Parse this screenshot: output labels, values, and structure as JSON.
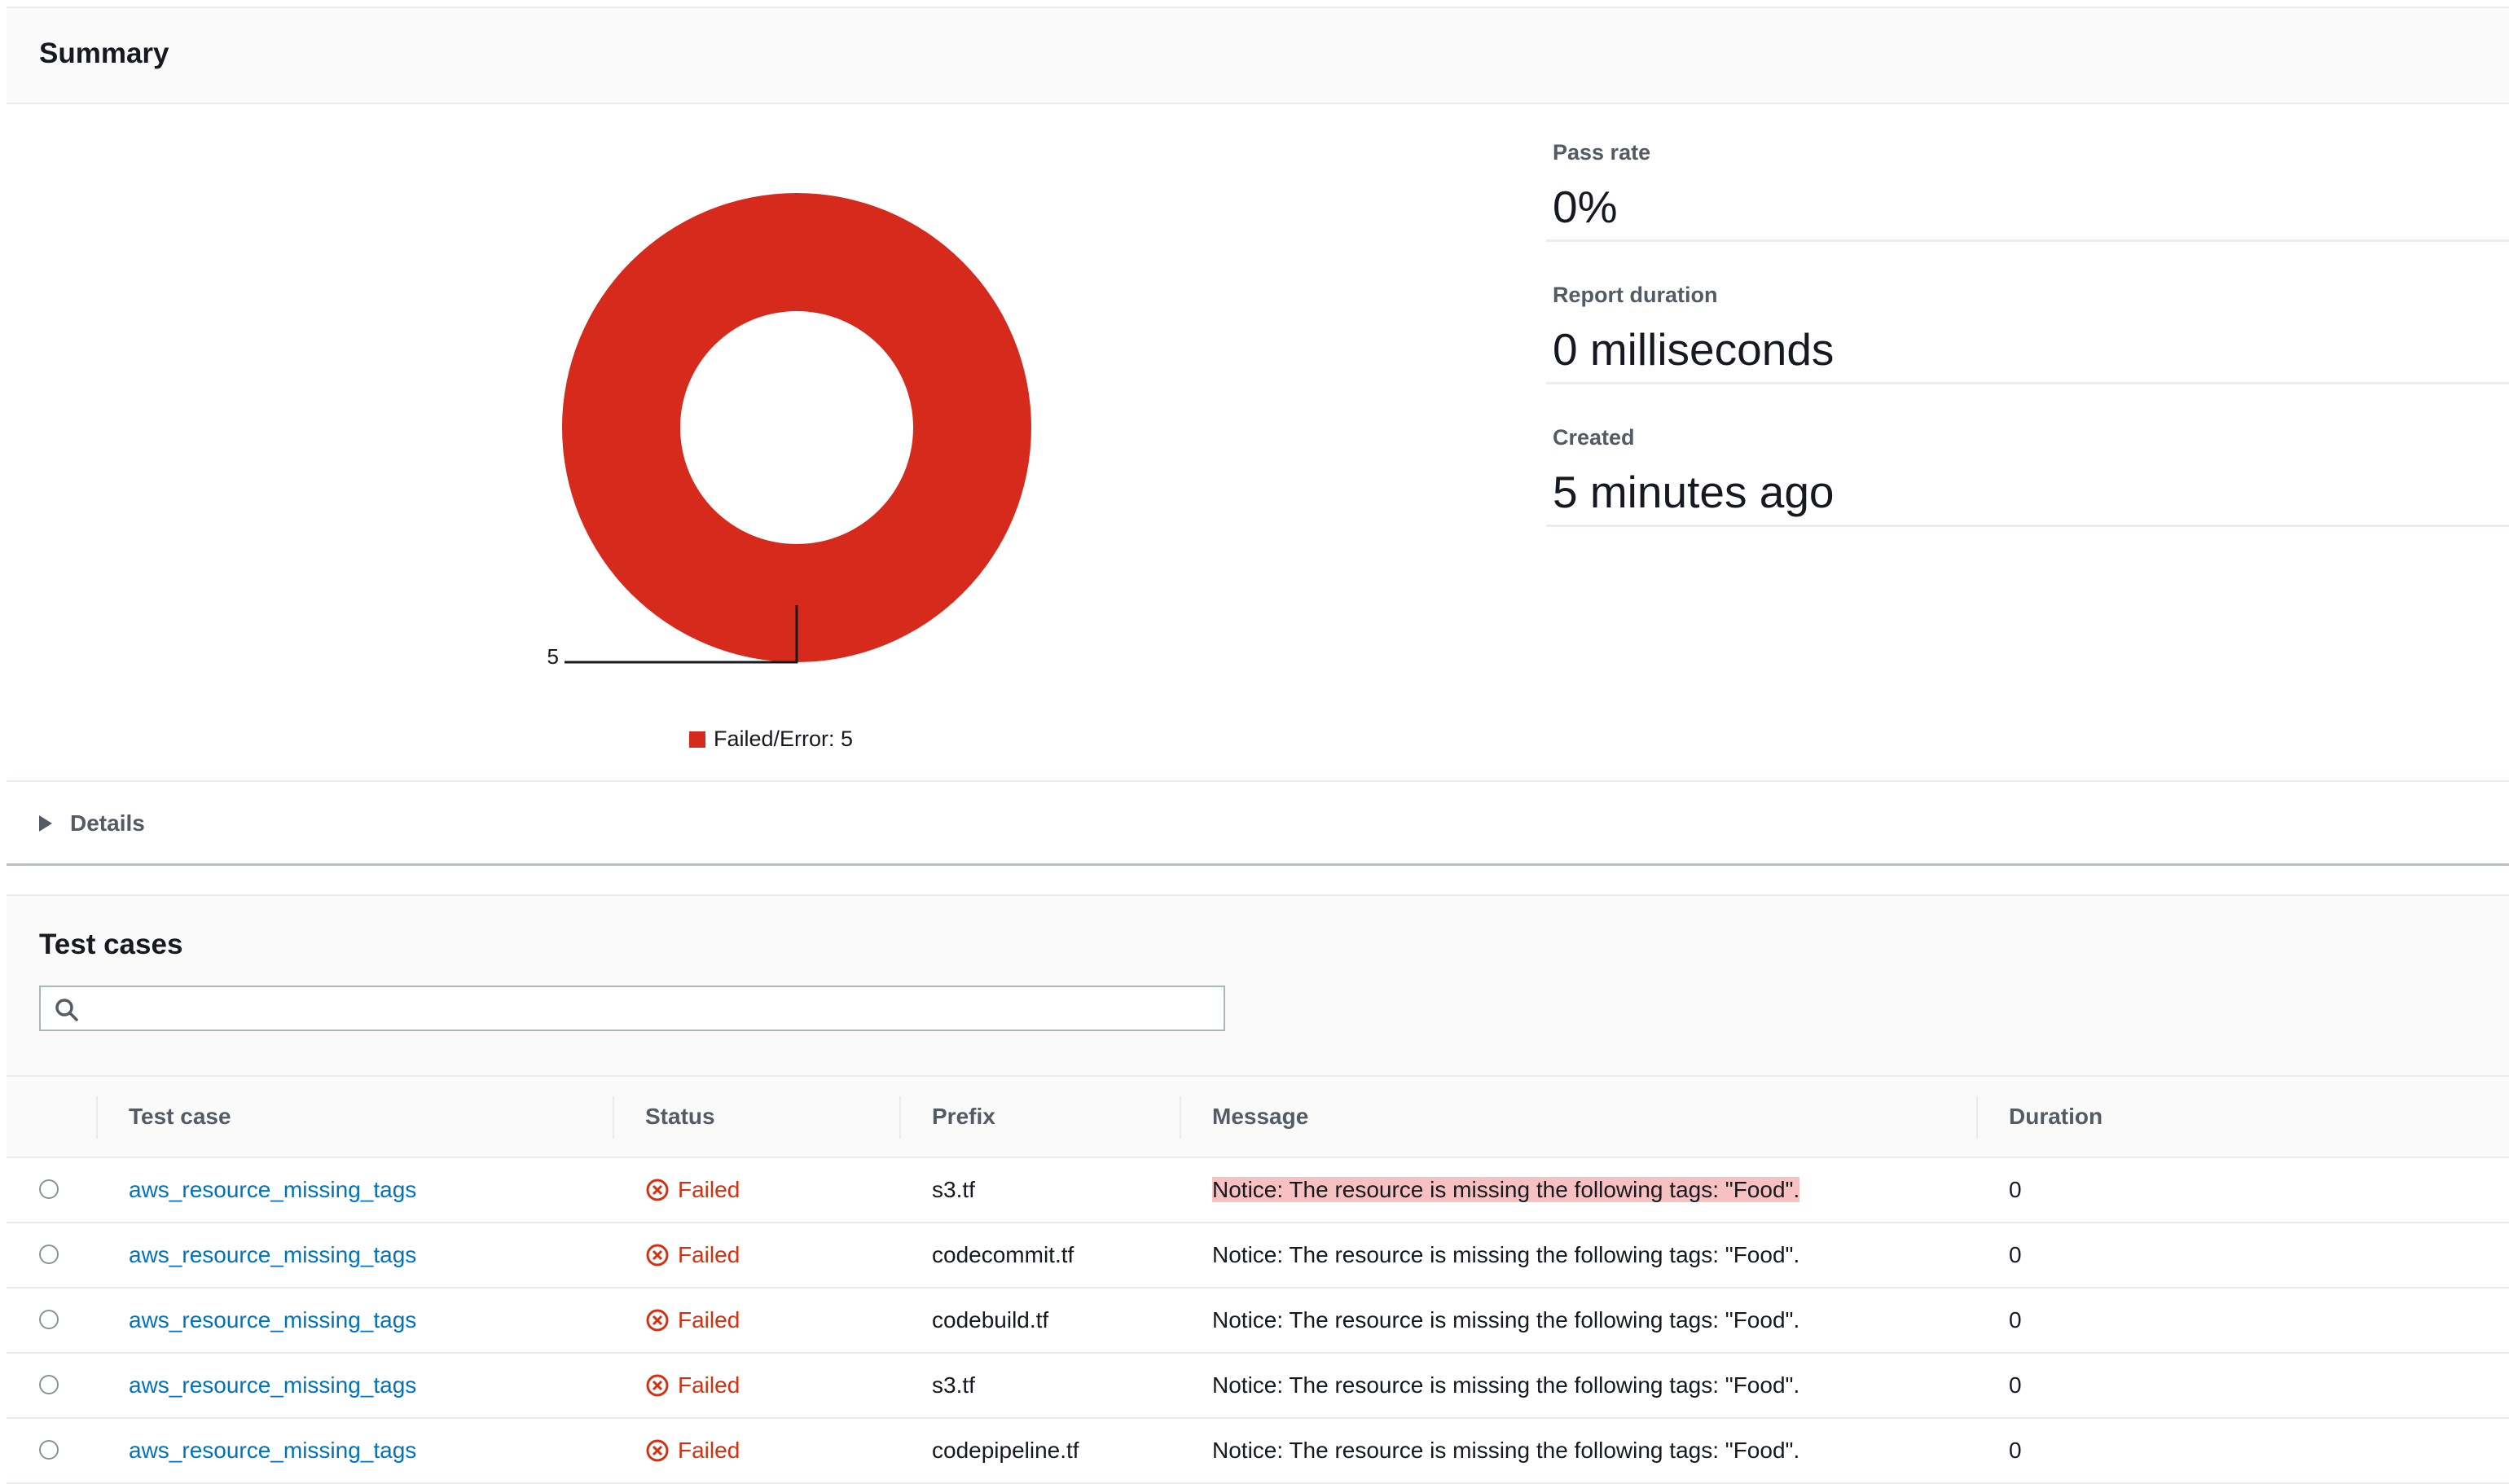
{
  "summary": {
    "title": "Summary",
    "metrics": {
      "pass_rate_label": "Pass rate",
      "pass_rate_value": "0%",
      "duration_label": "Report duration",
      "duration_value": "0 milliseconds",
      "created_label": "Created",
      "created_value": "5 minutes ago"
    },
    "details_label": "Details"
  },
  "chart_data": {
    "type": "pie",
    "categories": [
      "Failed/Error"
    ],
    "values": [
      5
    ],
    "data_labels": [
      "5"
    ],
    "legend": [
      "Failed/Error: 5"
    ],
    "colors": [
      "#d62a1c"
    ],
    "legend_position": "bottom"
  },
  "test_cases": {
    "title": "Test cases",
    "search_placeholder": "",
    "columns": [
      "Test case",
      "Status",
      "Prefix",
      "Message",
      "Duration"
    ],
    "rows": [
      {
        "test_case": "aws_resource_missing_tags",
        "status": "Failed",
        "prefix": "s3.tf",
        "message": "Notice: The resource is missing the following tags: \"Food\".",
        "duration": "0"
      },
      {
        "test_case": "aws_resource_missing_tags",
        "status": "Failed",
        "prefix": "codecommit.tf",
        "message": "Notice: The resource is missing the following tags: \"Food\".",
        "duration": "0"
      },
      {
        "test_case": "aws_resource_missing_tags",
        "status": "Failed",
        "prefix": "codebuild.tf",
        "message": "Notice: The resource is missing the following tags: \"Food\".",
        "duration": "0"
      },
      {
        "test_case": "aws_resource_missing_tags",
        "status": "Failed",
        "prefix": "s3.tf",
        "message": "Notice: The resource is missing the following tags: \"Food\".",
        "duration": "0"
      },
      {
        "test_case": "aws_resource_missing_tags",
        "status": "Failed",
        "prefix": "codepipeline.tf",
        "message": "Notice: The resource is missing the following tags: \"Food\".",
        "duration": "0"
      }
    ],
    "highlighted_message_row": 0
  },
  "colors": {
    "failed": "#d13212",
    "link": "#0073bb",
    "chart_fill": "#d62a1c"
  },
  "icons": {
    "status_failed": "x-circle-icon",
    "search": "search-icon",
    "details": "caret-right-icon"
  }
}
